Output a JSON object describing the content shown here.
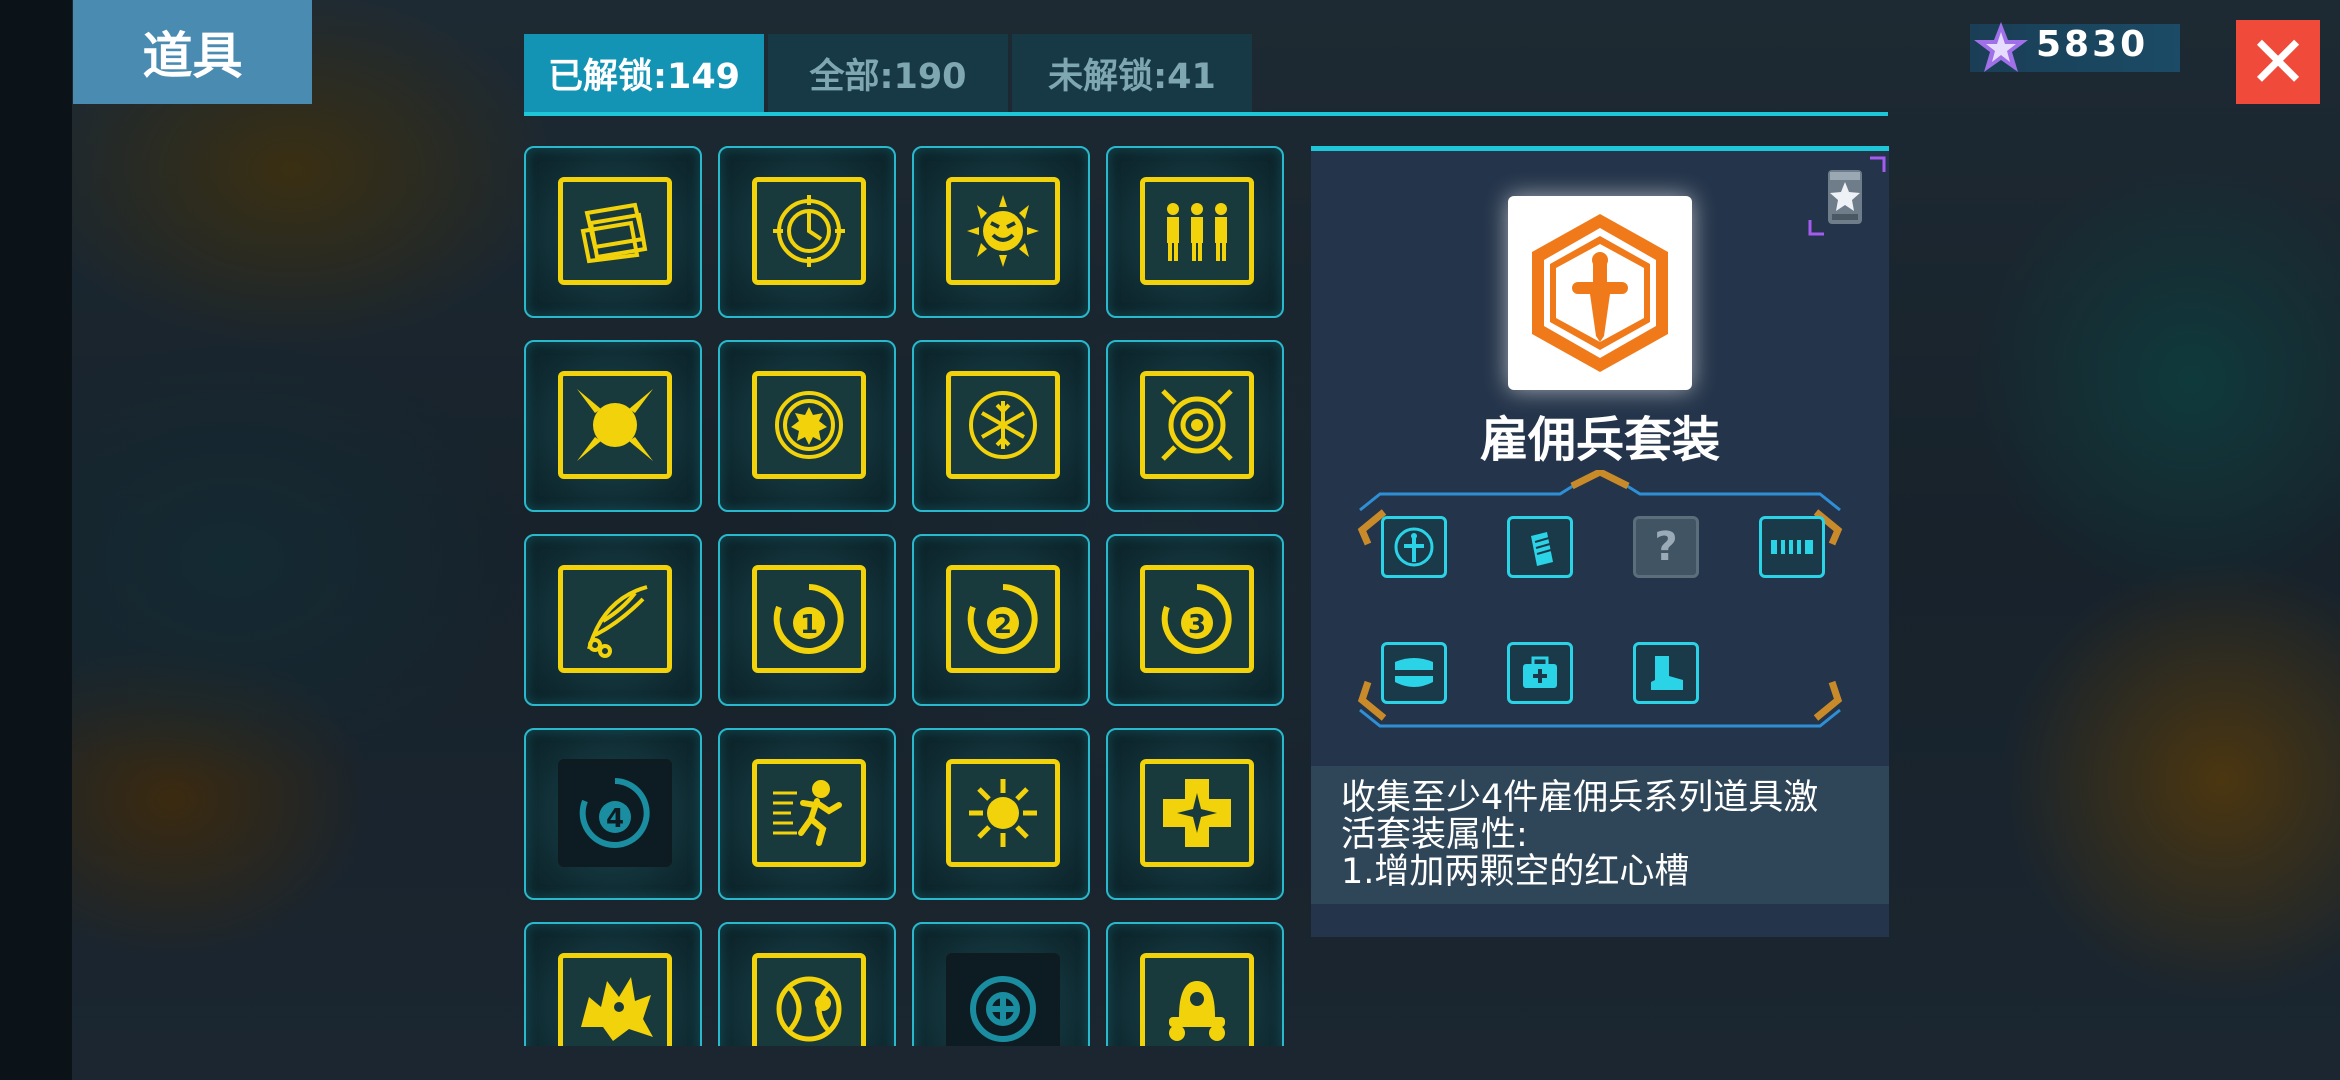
{
  "header": {
    "title": "道具"
  },
  "tabs": [
    {
      "label": "已解锁:149",
      "active": true
    },
    {
      "label": "全部:190",
      "active": false
    },
    {
      "label": "未解锁:41",
      "active": false
    }
  ],
  "currency": {
    "icon": "crystal-star-icon",
    "value": "5830"
  },
  "close_icon": "close-icon",
  "items": [
    {
      "icon": "cards-icon",
      "locked": false
    },
    {
      "icon": "clock-target-icon",
      "locked": false
    },
    {
      "icon": "angry-sun-icon",
      "locked": false
    },
    {
      "icon": "three-people-icon",
      "locked": false
    },
    {
      "icon": "sun-burst-icon",
      "locked": false
    },
    {
      "icon": "gear-shield-icon",
      "locked": false
    },
    {
      "icon": "snowflake-icon",
      "locked": false
    },
    {
      "icon": "spiral-eye-icon",
      "locked": false
    },
    {
      "icon": "feather-icon",
      "locked": false
    },
    {
      "icon": "circle-1-icon",
      "label": "1",
      "locked": false
    },
    {
      "icon": "circle-2-icon",
      "label": "2",
      "locked": false
    },
    {
      "icon": "circle-3-icon",
      "label": "3",
      "locked": false
    },
    {
      "icon": "circle-4-icon",
      "label": "4",
      "locked": true
    },
    {
      "icon": "runner-icon",
      "locked": false
    },
    {
      "icon": "star-burst-icon",
      "locked": false
    },
    {
      "icon": "cross-icon",
      "locked": false
    },
    {
      "icon": "beast-icon",
      "locked": false
    },
    {
      "icon": "lantern-icon",
      "locked": false
    },
    {
      "icon": "dark-gear-icon",
      "locked": true
    },
    {
      "icon": "bell-icon",
      "locked": false
    }
  ],
  "detail": {
    "set_name": "雇佣兵套装",
    "set_icon": "sword-hexagon-icon",
    "badge_icon": "star-badge-icon",
    "slots": [
      {
        "icon": "sword-icon",
        "unknown": false
      },
      {
        "icon": "ammo-icon",
        "unknown": false
      },
      {
        "icon": "question-icon",
        "label": "?",
        "unknown": true
      },
      {
        "icon": "bullet-belt-icon",
        "unknown": false
      },
      {
        "icon": "armor-icon",
        "unknown": false
      },
      {
        "icon": "medkit-icon",
        "unknown": false
      },
      {
        "icon": "boot-icon",
        "unknown": false
      }
    ],
    "description_lines": [
      "收集至少4件雇佣兵系列道具激",
      "活套装属性:",
      "1.增加两颗空的红心槽"
    ]
  },
  "colors": {
    "accent": "#1ec7d8",
    "gold": "#f2d20a",
    "tab_active": "#1494b4",
    "close": "#f04b3a",
    "title_bg": "#4a8bb2"
  }
}
